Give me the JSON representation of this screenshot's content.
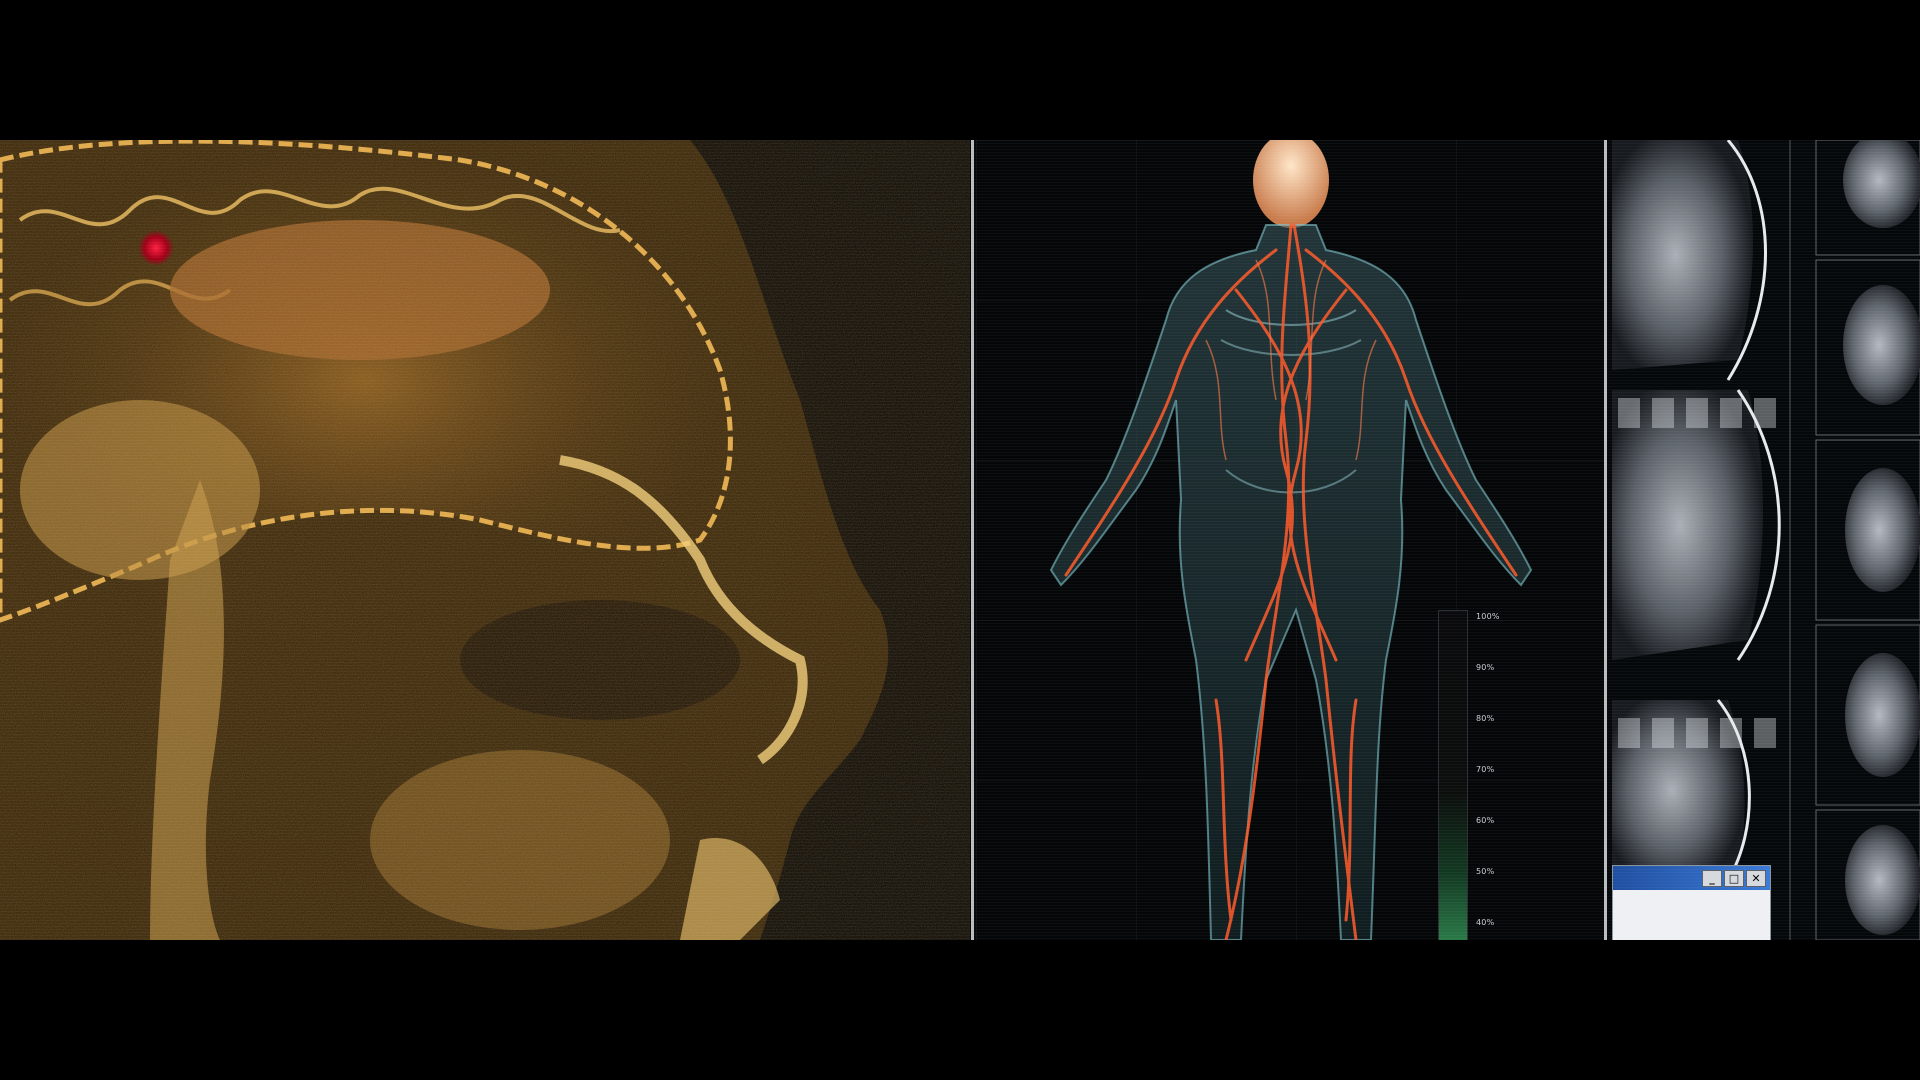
{
  "viewer": {
    "panels": [
      {
        "name": "Sagittal head MRI"
      },
      {
        "name": "Vascular body model"
      },
      {
        "name": "Axial brain slices"
      }
    ],
    "marker_color": "#d0102a",
    "vessel_color": "#ff5a2a",
    "mri_tint": "#c8902c"
  },
  "oxygen_scale": {
    "labels": [
      "100%",
      "90%",
      "80%",
      "70%",
      "60%",
      "50%",
      "40%"
    ],
    "fill_color": "#2a7a48"
  },
  "window_controls": {
    "minimize": "_",
    "maximize": "□",
    "close": "✕"
  }
}
